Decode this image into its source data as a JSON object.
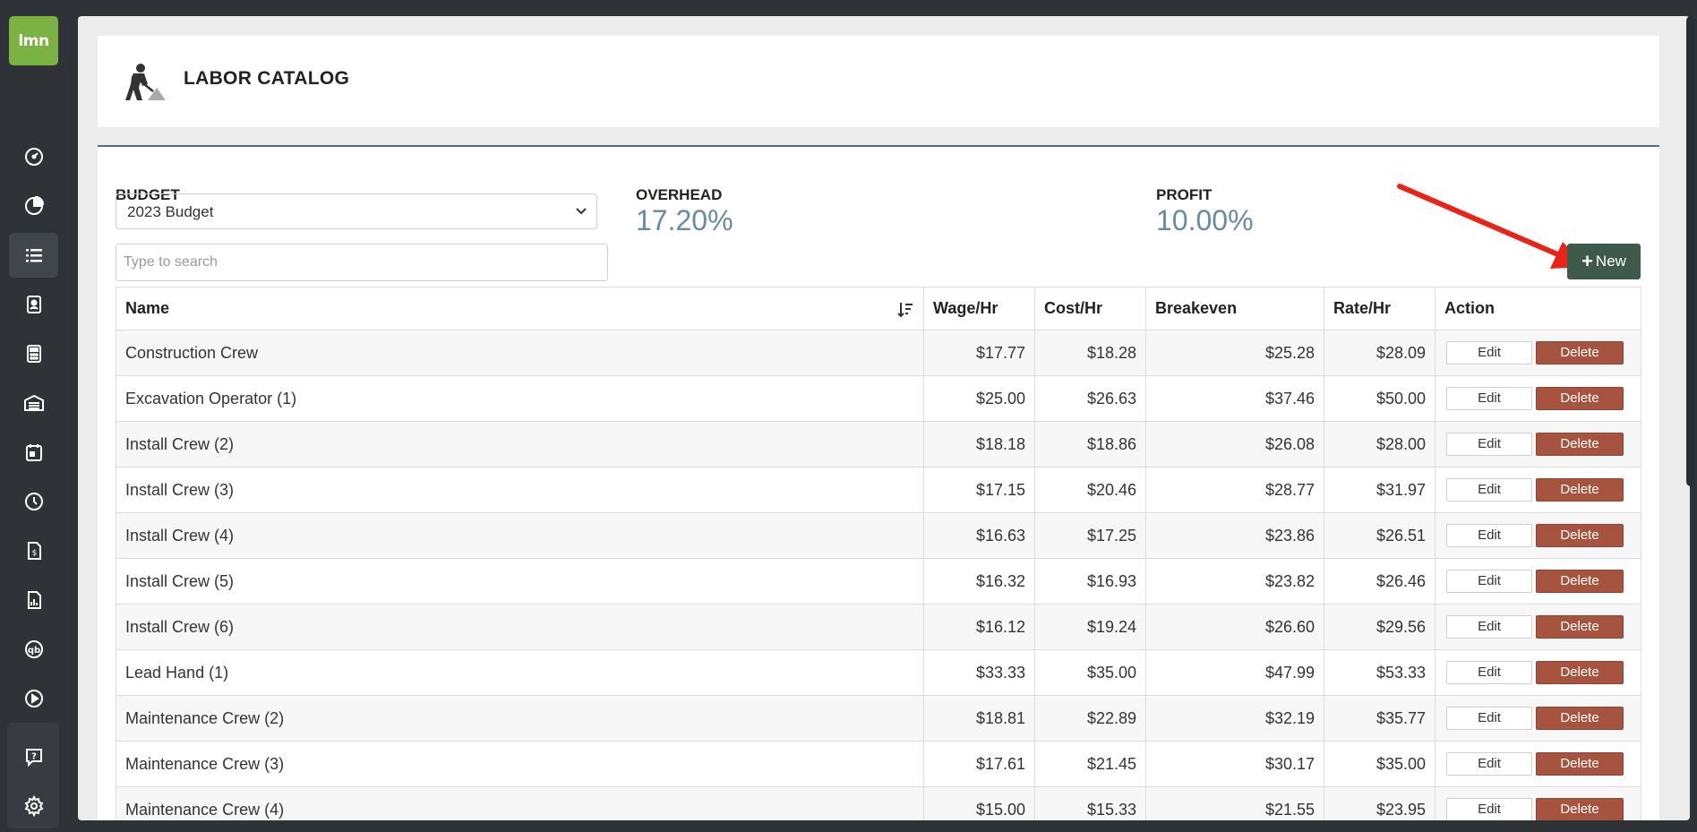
{
  "logo": {
    "text": "lmn"
  },
  "sidebar": {
    "items": [
      {
        "icon": "dashboard-icon"
      },
      {
        "icon": "pie-chart-icon"
      },
      {
        "icon": "list-icon",
        "active": true
      },
      {
        "icon": "contact-card-icon"
      },
      {
        "icon": "calculator-icon"
      },
      {
        "icon": "warehouse-icon"
      },
      {
        "icon": "calendar-icon"
      },
      {
        "icon": "clock-icon"
      },
      {
        "icon": "invoice-icon"
      },
      {
        "icon": "report-icon"
      },
      {
        "icon": "quickbooks-icon"
      },
      {
        "icon": "play-icon"
      },
      {
        "icon": "help-icon"
      },
      {
        "icon": "gear-icon"
      }
    ]
  },
  "header": {
    "title": "LABOR CATALOG",
    "icon": "worker-shovel-icon"
  },
  "budget": {
    "label": "BUDGET",
    "selected": "2023 Budget"
  },
  "overhead": {
    "label": "OVERHEAD",
    "value": "17.20%"
  },
  "profit": {
    "label": "PROFIT",
    "value": "10.00%"
  },
  "search": {
    "placeholder": "Type to search"
  },
  "new_button": {
    "label": "New"
  },
  "table": {
    "headers": [
      "Name",
      "Wage/Hr",
      "Cost/Hr",
      "Breakeven",
      "Rate/Hr",
      "Action"
    ],
    "edit_label": "Edit",
    "delete_label": "Delete",
    "rows": [
      {
        "name": "Construction Crew",
        "wage": "$17.77",
        "cost": "$18.28",
        "breakeven": "$25.28",
        "rate": "$28.09"
      },
      {
        "name": "Excavation Operator (1)",
        "wage": "$25.00",
        "cost": "$26.63",
        "breakeven": "$37.46",
        "rate": "$50.00"
      },
      {
        "name": "Install Crew (2)",
        "wage": "$18.18",
        "cost": "$18.86",
        "breakeven": "$26.08",
        "rate": "$28.00"
      },
      {
        "name": "Install Crew (3)",
        "wage": "$17.15",
        "cost": "$20.46",
        "breakeven": "$28.77",
        "rate": "$31.97"
      },
      {
        "name": "Install Crew (4)",
        "wage": "$16.63",
        "cost": "$17.25",
        "breakeven": "$23.86",
        "rate": "$26.51"
      },
      {
        "name": "Install Crew (5)",
        "wage": "$16.32",
        "cost": "$16.93",
        "breakeven": "$23.82",
        "rate": "$26.46"
      },
      {
        "name": "Install Crew (6)",
        "wage": "$16.12",
        "cost": "$19.24",
        "breakeven": "$26.60",
        "rate": "$29.56"
      },
      {
        "name": "Lead Hand (1)",
        "wage": "$33.33",
        "cost": "$35.00",
        "breakeven": "$47.99",
        "rate": "$53.33"
      },
      {
        "name": "Maintenance Crew (2)",
        "wage": "$18.81",
        "cost": "$22.89",
        "breakeven": "$32.19",
        "rate": "$35.77"
      },
      {
        "name": "Maintenance Crew (3)",
        "wage": "$17.61",
        "cost": "$21.45",
        "breakeven": "$30.17",
        "rate": "$35.00"
      },
      {
        "name": "Maintenance Crew (4)",
        "wage": "$15.00",
        "cost": "$15.33",
        "breakeven": "$21.55",
        "rate": "$23.95"
      }
    ]
  },
  "colors": {
    "sidebar_bg": "#2f3237",
    "logo_green": "#7bb342",
    "accent_blue": "#6a8aa0",
    "new_button": "#3d5a4d",
    "delete_button": "#a65440",
    "annotation_arrow": "#e8241a"
  }
}
